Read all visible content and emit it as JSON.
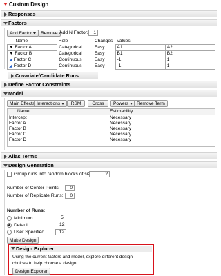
{
  "title": "Custom Design",
  "sections": {
    "responses": "Responses",
    "factors": "Factors",
    "covariate": "Covariate/Candidate Runs",
    "constraints": "Define Factor Constraints",
    "model": "Model",
    "alias": "Alias Terms",
    "design_generation": "Design Generation",
    "design_explorer": "Design Explorer"
  },
  "factors_toolbar": {
    "add_factor": "Add Factor",
    "remove": "Remove",
    "add_n_label": "Add N Factors",
    "add_n_value": "1"
  },
  "factors_table": {
    "headers": [
      "Name",
      "Role",
      "Changes",
      "Values"
    ],
    "rows": [
      {
        "name": "Factor A",
        "role": "Categorical",
        "changes": "Easy",
        "v1": "A1",
        "v2": "A2"
      },
      {
        "name": "Factor B",
        "role": "Categorical",
        "changes": "Easy",
        "v1": "B1",
        "v2": "B2"
      },
      {
        "name": "Factor C",
        "role": "Continuous",
        "changes": "Easy",
        "v1": "-1",
        "v2": "1"
      },
      {
        "name": "Factor D",
        "role": "Continuous",
        "changes": "Easy",
        "v1": "-1",
        "v2": "1"
      }
    ]
  },
  "model_toolbar": {
    "main_effects": "Main Effects",
    "interactions": "Interactions",
    "rsm": "RSM",
    "cross": "Cross",
    "powers": "Powers",
    "remove_term": "Remove Term"
  },
  "model_table": {
    "headers": [
      "Name",
      "Estimability"
    ],
    "rows": [
      {
        "name": "Intercept",
        "est": "Necessary"
      },
      {
        "name": "Factor A",
        "est": "Necessary"
      },
      {
        "name": "Factor B",
        "est": "Necessary"
      },
      {
        "name": "Factor C",
        "est": "Necessary"
      },
      {
        "name": "Factor D",
        "est": "Necessary"
      }
    ]
  },
  "design_generation": {
    "group_runs_label": "Group runs into random blocks of size:",
    "block_size": "2",
    "center_points_label": "Number of Center Points:",
    "center_points": "0",
    "replicate_runs_label": "Number of Replicate Runs:",
    "replicate_runs": "0",
    "number_of_runs_label": "Number of Runs:",
    "minimum_label": "Minimum",
    "minimum_value": "5",
    "default_label": "Default",
    "default_value": "12",
    "user_specified_label": "User Specified",
    "user_specified_value": "12",
    "make_design": "Make Design"
  },
  "explorer": {
    "text_line1": "Using the current factors and model, explore different design",
    "text_line2": "choices to help choose a design.",
    "button": "Design Explorer"
  },
  "colors": {
    "highlight_box": "#d8121b",
    "header_bg": "#e8e8e8"
  }
}
